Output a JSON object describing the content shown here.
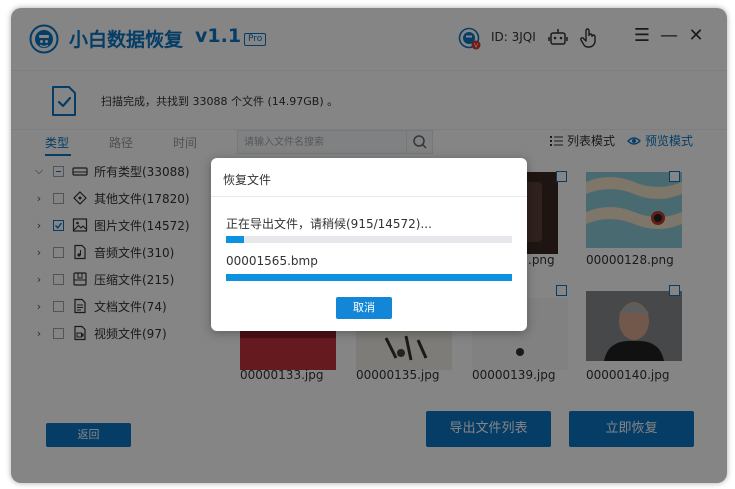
{
  "header": {
    "title": "小白数据恢复",
    "version": "v1.1",
    "badge": "Pro",
    "user_id": "ID: 3JQI"
  },
  "status": {
    "text": "扫描完成，共找到 33088 个文件 (14.97GB) 。"
  },
  "tabs": [
    "类型",
    "路径",
    "时间"
  ],
  "search": {
    "placeholder": "请输入文件名搜索"
  },
  "view_modes": {
    "list": "列表模式",
    "preview": "预览模式"
  },
  "tree": {
    "root": "所有类型(33088)",
    "items": [
      {
        "label": "其他文件(17820)",
        "checked": false,
        "icon": "other-file-icon"
      },
      {
        "label": "图片文件(14572)",
        "checked": true,
        "icon": "image-file-icon"
      },
      {
        "label": "音频文件(310)",
        "checked": false,
        "icon": "audio-file-icon"
      },
      {
        "label": "压缩文件(215)",
        "checked": false,
        "icon": "archive-file-icon"
      },
      {
        "label": "文档文件(74)",
        "checked": false,
        "icon": "document-file-icon"
      },
      {
        "label": "视频文件(97)",
        "checked": false,
        "icon": "video-file-icon"
      }
    ]
  },
  "grid": {
    "row1": [
      ".png",
      "00000128.png"
    ],
    "row2": [
      "00000133.jpg",
      "00000135.jpg",
      "00000139.jpg",
      "00000140.jpg"
    ]
  },
  "buttons": {
    "back": "返回",
    "export_list": "导出文件列表",
    "recover_now": "立即恢复"
  },
  "dialog": {
    "title": "恢复文件",
    "message": "正在导出文件，请稍候(915/14572)...",
    "overall_progress": 0.063,
    "current_file": "00001565.bmp",
    "file_progress": 1.0,
    "cancel": "取消"
  },
  "colors": {
    "accent": "#0a76c4",
    "progress": "#0e92df"
  }
}
